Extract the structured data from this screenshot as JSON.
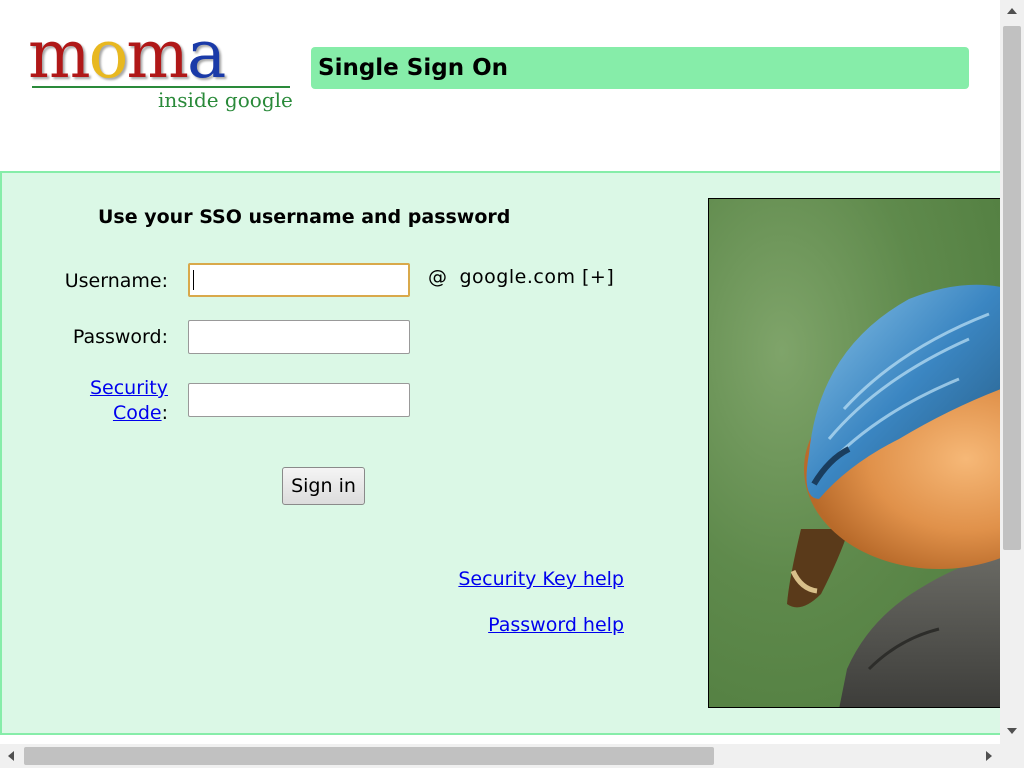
{
  "logo": {
    "letters": [
      {
        "char": "m",
        "color": "#b01818"
      },
      {
        "char": "o",
        "color": "#e8b820"
      },
      {
        "char": "m",
        "color": "#b01818"
      },
      {
        "char": "a",
        "color": "#1a3aa8"
      }
    ],
    "subtitle": "inside google"
  },
  "header": {
    "title": "Single Sign On"
  },
  "form": {
    "heading": "Use your SSO username and password",
    "username_label": "Username:",
    "username_value": "",
    "domain_at": "@",
    "domain": "google.com",
    "domain_toggle": "[+]",
    "password_label": "Password:",
    "password_value": "",
    "security_link_line1": "Security",
    "security_link_line2": "Code",
    "security_colon": ":",
    "security_value": "",
    "signin_label": "Sign in"
  },
  "help": {
    "security_key": "Security Key help",
    "password": "Password help"
  },
  "colors": {
    "accent": "#86eda9",
    "panel_bg": "#dbf8e6",
    "link": "#0000ee",
    "focus": "#d9a94b"
  },
  "photo": {
    "subject": "kingfisher bird on rock"
  },
  "icons": {
    "scroll_up": "triangle-up-icon",
    "scroll_down": "triangle-down-icon",
    "scroll_left": "triangle-left-icon",
    "scroll_right": "triangle-right-icon"
  }
}
